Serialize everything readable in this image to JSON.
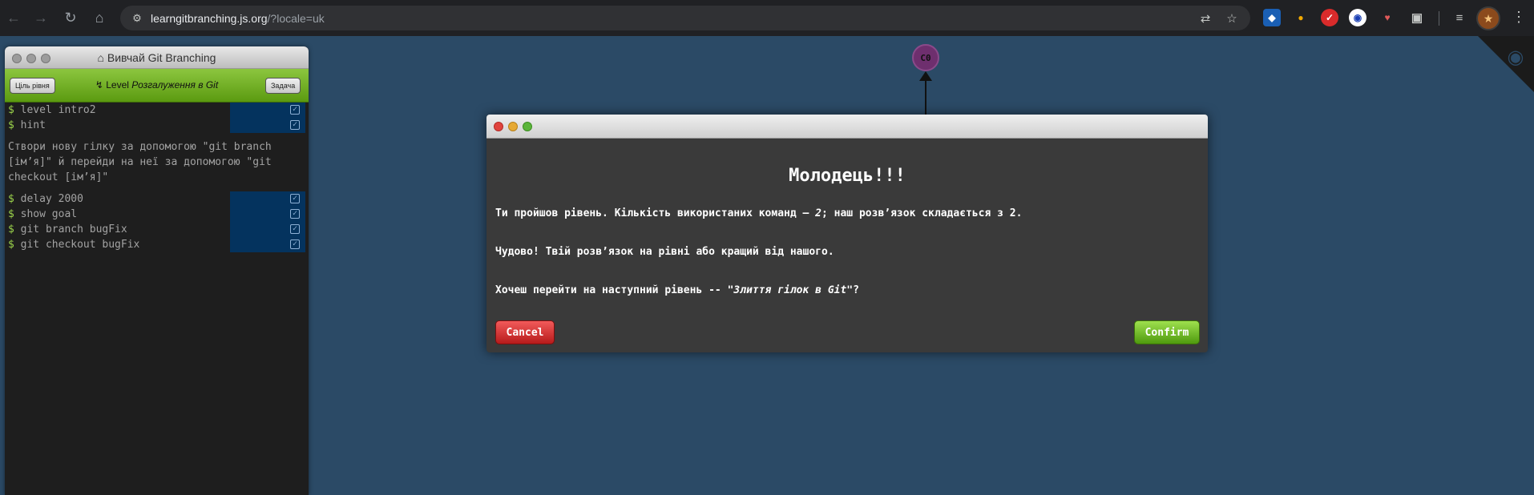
{
  "browser": {
    "url_host": "learngitbranching.js.org",
    "url_path": "/?locale=uk",
    "back_icon": "back-arrow-icon",
    "forward_icon": "forward-arrow-icon",
    "reload_icon": "reload-icon",
    "home_icon": "home-icon"
  },
  "terminal": {
    "window_title": "Вивчай Git Branching",
    "objective_button": "Ціль рівня",
    "level_prefix": "Level",
    "level_name": "Розгалуження в Git",
    "task_button": "Задача",
    "commands_top": [
      {
        "text": "level intro2"
      },
      {
        "text": "hint"
      }
    ],
    "hint_text": "Створи нову гілку за допомогою \"git branch [ім’я]\" й перейди на неї за допомогою \"git checkout [ім’я]\"",
    "commands_bottom": [
      {
        "text": "delay 2000"
      },
      {
        "text": "show goal"
      },
      {
        "text": "git branch bugFix"
      },
      {
        "text": "git checkout bugFix"
      }
    ]
  },
  "graph": {
    "commit_label": "C0"
  },
  "modal": {
    "heading": "Молодець!!!",
    "line1_prefix": "Ти пройшов рівень. Кількість використаних команд — ",
    "line1_count": "2",
    "line1_suffix": "; наш розв’язок складається з 2.",
    "line2": "Чудово! Твій розв’язок на рівні або кращий від нашого.",
    "line3_prefix": "Хочеш перейти на наступний рівень -- ",
    "line3_level": "\"Злиття гілок в Git\"",
    "line3_suffix": "?",
    "cancel_label": "Cancel",
    "confirm_label": "Confirm"
  },
  "colors": {
    "background": "#2b4a66",
    "level_bar": "#7bb52c",
    "commit_node": "#6e2f6e",
    "cancel": "#d83232",
    "confirm": "#6fbb1f"
  }
}
